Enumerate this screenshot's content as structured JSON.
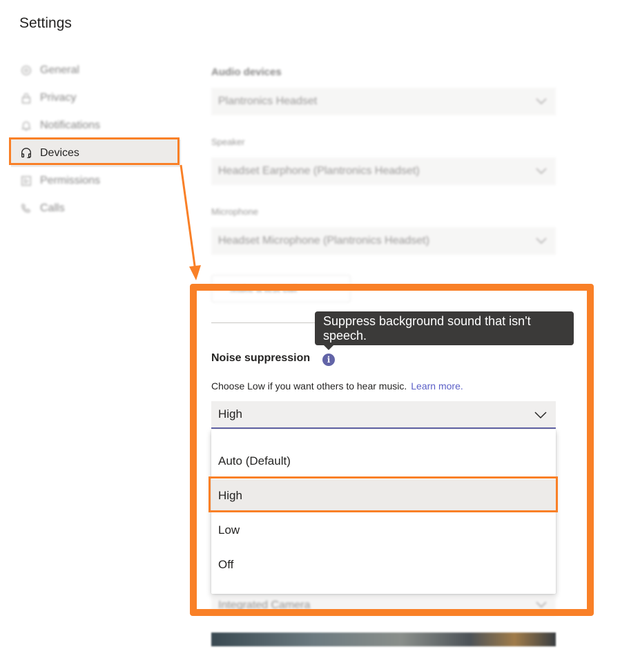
{
  "page": {
    "title": "Settings"
  },
  "sidebar": {
    "items": [
      {
        "label": "General",
        "icon": "gear-icon"
      },
      {
        "label": "Privacy",
        "icon": "lock-icon"
      },
      {
        "label": "Notifications",
        "icon": "bell-icon"
      },
      {
        "label": "Devices",
        "icon": "headset-icon",
        "active": true
      },
      {
        "label": "Permissions",
        "icon": "permissions-icon"
      },
      {
        "label": "Calls",
        "icon": "phone-icon"
      }
    ]
  },
  "audio": {
    "heading": "Audio devices",
    "device_value": "Plantronics Headset",
    "speaker_label": "Speaker",
    "speaker_value": "Headset Earphone (Plantronics Headset)",
    "microphone_label": "Microphone",
    "microphone_value": "Headset Microphone (Plantronics Headset)",
    "test_call_label": "Make a test call"
  },
  "noise": {
    "title": "Noise suppression",
    "info_glyph": "i",
    "tooltip": "Suppress background sound that isn't speech.",
    "description": "Choose Low if you want others to hear music.",
    "learn_more": "Learn more.",
    "selected": "High",
    "options": [
      "Auto (Default)",
      "High",
      "Low",
      "Off"
    ]
  },
  "camera": {
    "value": "Integrated Camera"
  },
  "colors": {
    "accent": "#6264a7",
    "callout": "#f98027",
    "selected_bg": "#edebe9"
  }
}
